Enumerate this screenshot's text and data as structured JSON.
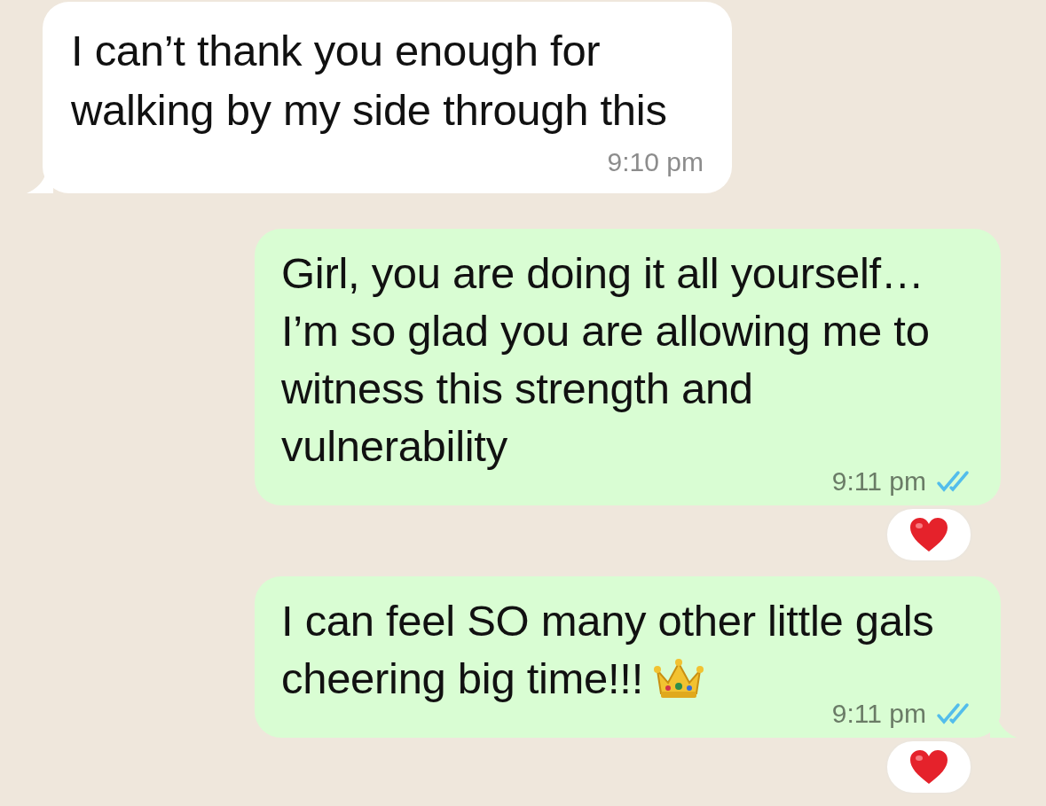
{
  "messages": [
    {
      "kind": "incoming",
      "text": "I can’t thank you enough for\nwalking by my side through this",
      "time": "9:10 pm",
      "tail": true,
      "reacted": false
    },
    {
      "kind": "outgoing",
      "text": "Girl, you are doing it all yourself…\nI’m so glad you are allowing me to\nwitness this strength and\nvulnerability",
      "time": "9:11 pm",
      "read": true,
      "tail": false,
      "reacted": true,
      "ends_with_emoji": false
    },
    {
      "kind": "outgoing",
      "text": "I can feel SO many other little gals\ncheering big time!!!",
      "time": "9:11 pm",
      "read": true,
      "tail": true,
      "reacted": true,
      "ends_with_emoji": true
    }
  ]
}
